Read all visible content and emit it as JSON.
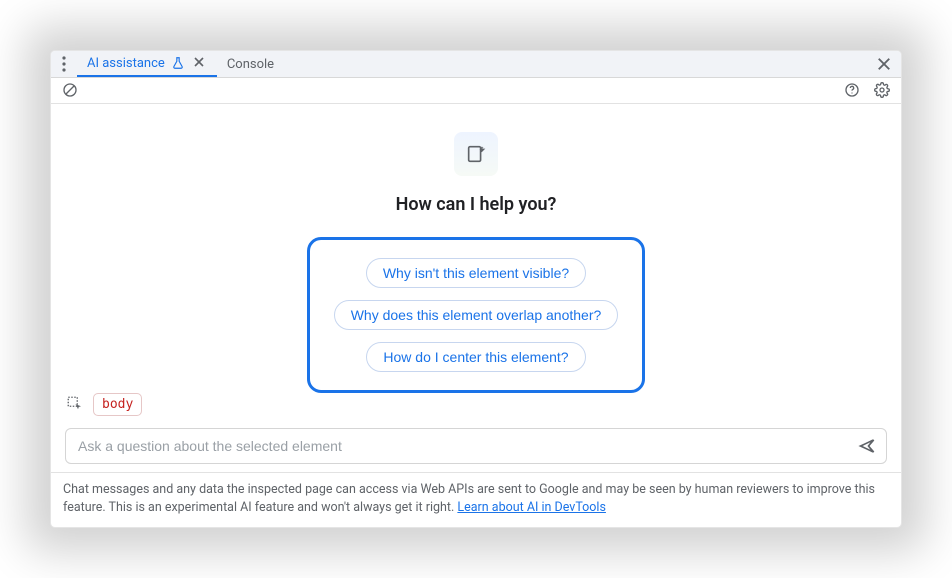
{
  "tabs": {
    "items": [
      {
        "label": "AI assistance",
        "active": true,
        "closable": true,
        "hasFlask": true
      },
      {
        "label": "Console",
        "active": false,
        "closable": false,
        "hasFlask": false
      }
    ]
  },
  "main": {
    "title": "How can I help you?",
    "suggestions": [
      "Why isn't this element visible?",
      "Why does this element overlap another?",
      "How do I center this element?"
    ]
  },
  "context": {
    "element": "body"
  },
  "input": {
    "placeholder": "Ask a question about the selected element",
    "value": ""
  },
  "footer": {
    "text": "Chat messages and any data the inspected page can access via Web APIs are sent to Google and may be seen by human reviewers to improve this feature. This is an experimental AI feature and won't always get it right. ",
    "link": "Learn about AI in DevTools"
  }
}
